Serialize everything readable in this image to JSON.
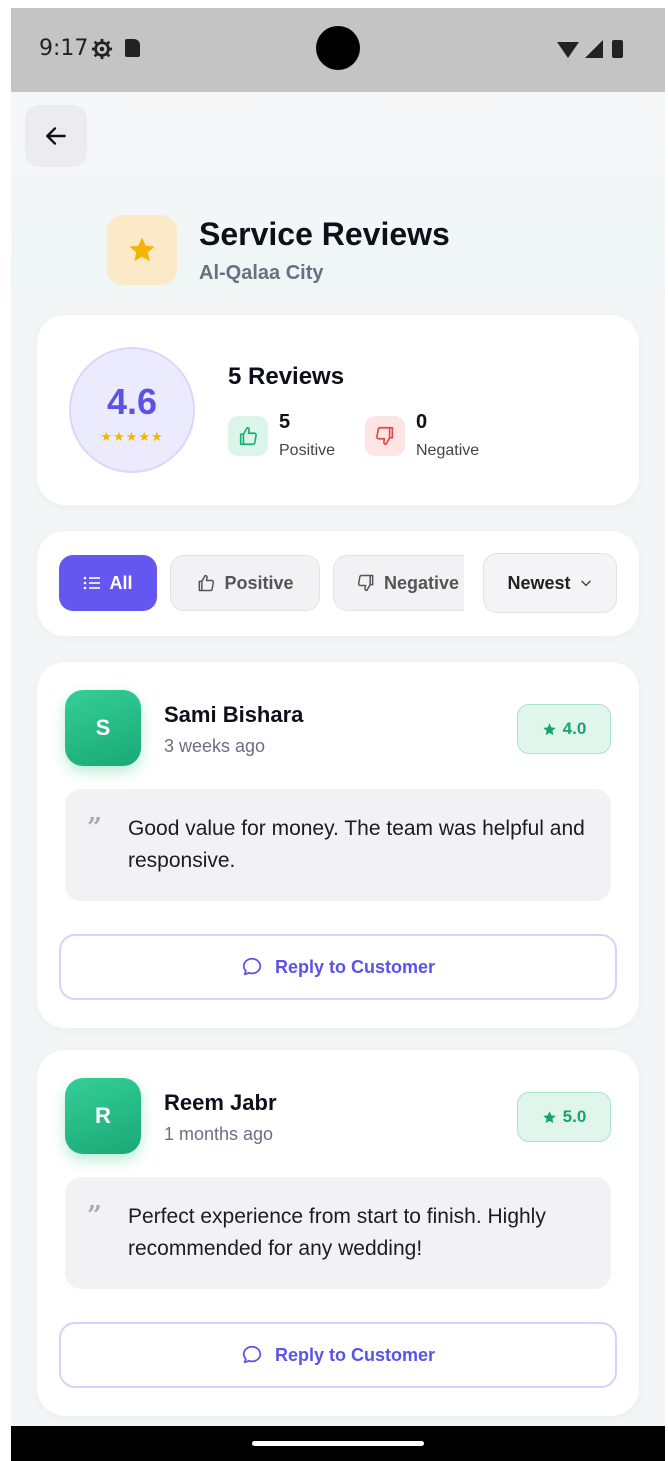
{
  "status_bar": {
    "time": "9:17"
  },
  "header": {
    "title": "Service Reviews",
    "subtitle": "Al-Qalaa City",
    "title_icon": "star-icon",
    "back_icon": "arrow-left-icon"
  },
  "summary": {
    "rating": "4.6",
    "stars": "★★★★★",
    "reviews_count": "5 Reviews",
    "positive_count": "5",
    "positive_label": "Positive",
    "negative_count": "0",
    "negative_label": "Negative"
  },
  "filters": {
    "all_label": "All",
    "positive_label": "Positive",
    "negative_label": "Negative",
    "sort_label": "Newest",
    "active": "All"
  },
  "reviews": [
    {
      "initial": "S",
      "name": "Sami Bishara",
      "time": "3 weeks ago",
      "score": "4.0",
      "comment": "Good value for money. The team was helpful and responsive.",
      "reply_label": "Reply to Customer"
    },
    {
      "initial": "R",
      "name": "Reem Jabr",
      "time": "1 months ago",
      "score": "5.0",
      "comment": "Perfect experience from start to finish. Highly recommended for any wedding!",
      "reply_label": "Reply to Customer"
    }
  ],
  "colors": {
    "accent": "#6357f0",
    "positive": "#18a36a",
    "negative": "#e04848",
    "star": "#f4b400"
  }
}
